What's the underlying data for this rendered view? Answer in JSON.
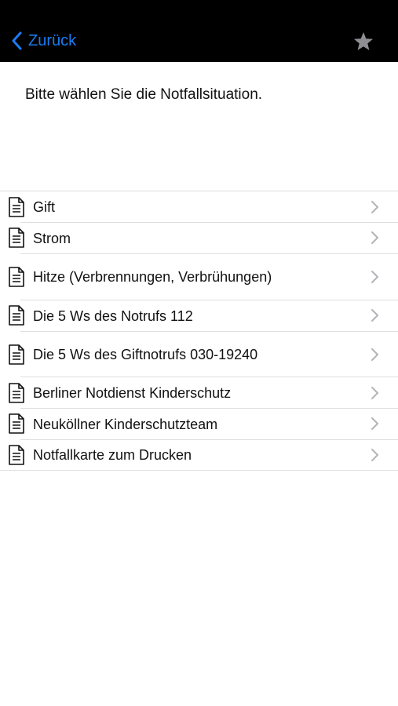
{
  "navbar": {
    "back_label": "Zurück",
    "accent_color": "#1a7cf0",
    "back_icon": "chevron-left-icon",
    "favorite_icon": "star-icon"
  },
  "prompt": "Bitte wählen Sie die Notfallsituation.",
  "list": {
    "row_icon": "document-icon",
    "disclosure_icon": "chevron-right-icon",
    "items": [
      {
        "label": "Gift"
      },
      {
        "label": "Strom"
      },
      {
        "label": "Hitze (Verbrennungen, Verbrühungen)"
      },
      {
        "label": "Die 5 Ws des Notrufs 112"
      },
      {
        "label": "Die 5 Ws des Giftnotrufs 030-19240"
      },
      {
        "label": "Berliner Notdienst Kinderschutz"
      },
      {
        "label": "Neuköllner Kinderschutzteam"
      },
      {
        "label": "Notfallkarte zum Drucken"
      }
    ]
  }
}
